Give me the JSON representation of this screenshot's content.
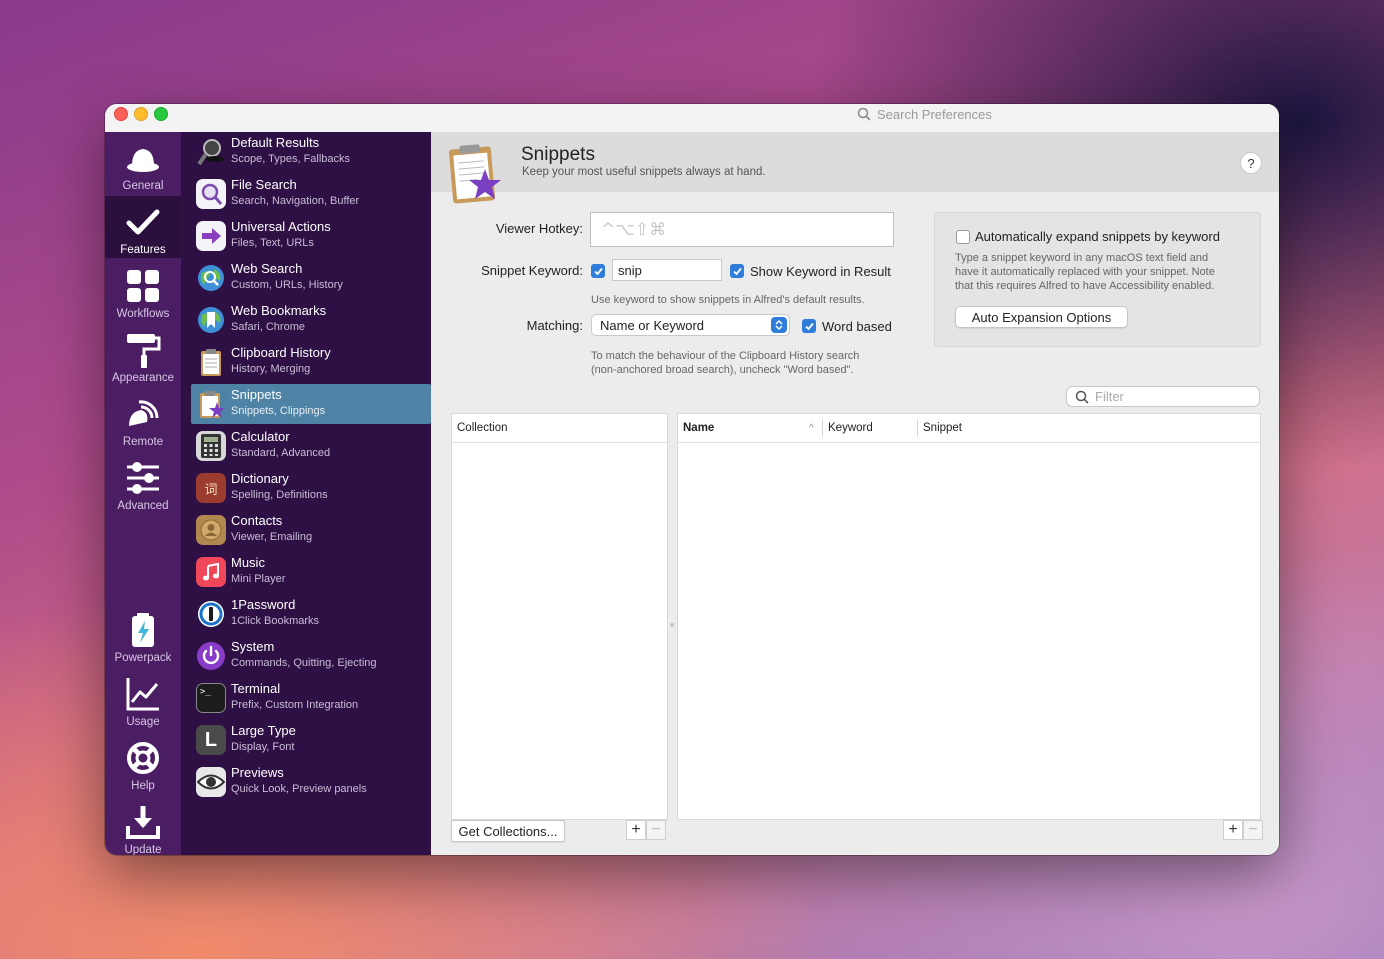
{
  "window": {
    "search_placeholder": "Search Preferences"
  },
  "sidebar": {
    "items": [
      {
        "label": "General",
        "icon": "hat-icon"
      },
      {
        "label": "Features",
        "icon": "checkmark-icon",
        "active": true
      },
      {
        "label": "Workflows",
        "icon": "grid-icon"
      },
      {
        "label": "Appearance",
        "icon": "paint-roller-icon"
      },
      {
        "label": "Remote",
        "icon": "remote-icon"
      },
      {
        "label": "Advanced",
        "icon": "sliders-icon"
      }
    ],
    "bottom_items": [
      {
        "label": "Powerpack",
        "icon": "battery-icon"
      },
      {
        "label": "Usage",
        "icon": "chart-icon"
      },
      {
        "label": "Help",
        "icon": "lifebuoy-icon"
      },
      {
        "label": "Update",
        "icon": "download-icon"
      }
    ]
  },
  "features": [
    {
      "title": "Default Results",
      "subtitle": "Scope, Types, Fallbacks",
      "icon": "magnifier-hat-icon"
    },
    {
      "title": "File Search",
      "subtitle": "Search, Navigation, Buffer",
      "icon": "file-search-icon"
    },
    {
      "title": "Universal Actions",
      "subtitle": "Files, Text, URLs",
      "icon": "arrow-icon"
    },
    {
      "title": "Web Search",
      "subtitle": "Custom, URLs, History",
      "icon": "globe-search-icon"
    },
    {
      "title": "Web Bookmarks",
      "subtitle": "Safari, Chrome",
      "icon": "globe-bookmark-icon"
    },
    {
      "title": "Clipboard History",
      "subtitle": "History, Merging",
      "icon": "clipboard-icon"
    },
    {
      "title": "Snippets",
      "subtitle": "Snippets, Clippings",
      "icon": "snippets-icon",
      "selected": true
    },
    {
      "title": "Calculator",
      "subtitle": "Standard, Advanced",
      "icon": "calculator-icon"
    },
    {
      "title": "Dictionary",
      "subtitle": "Spelling, Definitions",
      "icon": "dictionary-icon"
    },
    {
      "title": "Contacts",
      "subtitle": "Viewer, Emailing",
      "icon": "contacts-icon"
    },
    {
      "title": "Music",
      "subtitle": "Mini Player",
      "icon": "music-icon"
    },
    {
      "title": "1Password",
      "subtitle": "1Click Bookmarks",
      "icon": "1password-icon"
    },
    {
      "title": "System",
      "subtitle": "Commands, Quitting, Ejecting",
      "icon": "power-icon"
    },
    {
      "title": "Terminal",
      "subtitle": "Prefix, Custom Integration",
      "icon": "terminal-icon"
    },
    {
      "title": "Large Type",
      "subtitle": "Display, Font",
      "icon": "large-type-icon"
    },
    {
      "title": "Previews",
      "subtitle": "Quick Look, Preview panels",
      "icon": "eye-icon"
    }
  ],
  "dictionary_glyph": "词",
  "large_type_glyph": "L",
  "terminal_glyph": ">_",
  "header": {
    "title": "Snippets",
    "subtitle": "Keep your most useful snippets always at hand.",
    "help": "?"
  },
  "form": {
    "viewer_hotkey_label": "Viewer Hotkey:",
    "viewer_hotkey_placeholder": "^⌥⇧⌘",
    "snippet_keyword_label": "Snippet Keyword:",
    "snippet_keyword_value": "snip",
    "show_keyword_label": "Show Keyword in Result",
    "keyword_hint": "Use keyword to show snippets in Alfred's default results.",
    "matching_label": "Matching:",
    "matching_value": "Name or Keyword",
    "word_based_label": "Word based",
    "matching_hint_1": "To match the behaviour of the Clipboard History search",
    "matching_hint_2": "(non-anchored broad search), uncheck \"Word based\"."
  },
  "auto_expand": {
    "label": "Automatically expand snippets by keyword",
    "desc_1": "Type a snippet keyword in any macOS text field and",
    "desc_2": "have it automatically replaced with your snippet. Note",
    "desc_3": "that this requires Alfred to have Accessibility enabled.",
    "button": "Auto Expansion Options"
  },
  "filter_placeholder": "Filter",
  "collections": {
    "header": "Collection",
    "get_button": "Get Collections...",
    "add": "+",
    "remove": "−"
  },
  "snippets_table": {
    "columns": [
      "Name",
      "Keyword",
      "Snippet"
    ],
    "sort_indicator": "^",
    "add": "+",
    "remove": "−"
  },
  "colors": {
    "sidebar": "#4b1d63",
    "feature_list": "#2e1045",
    "selected": "#4e83a6",
    "accent": "#2f7dda"
  }
}
